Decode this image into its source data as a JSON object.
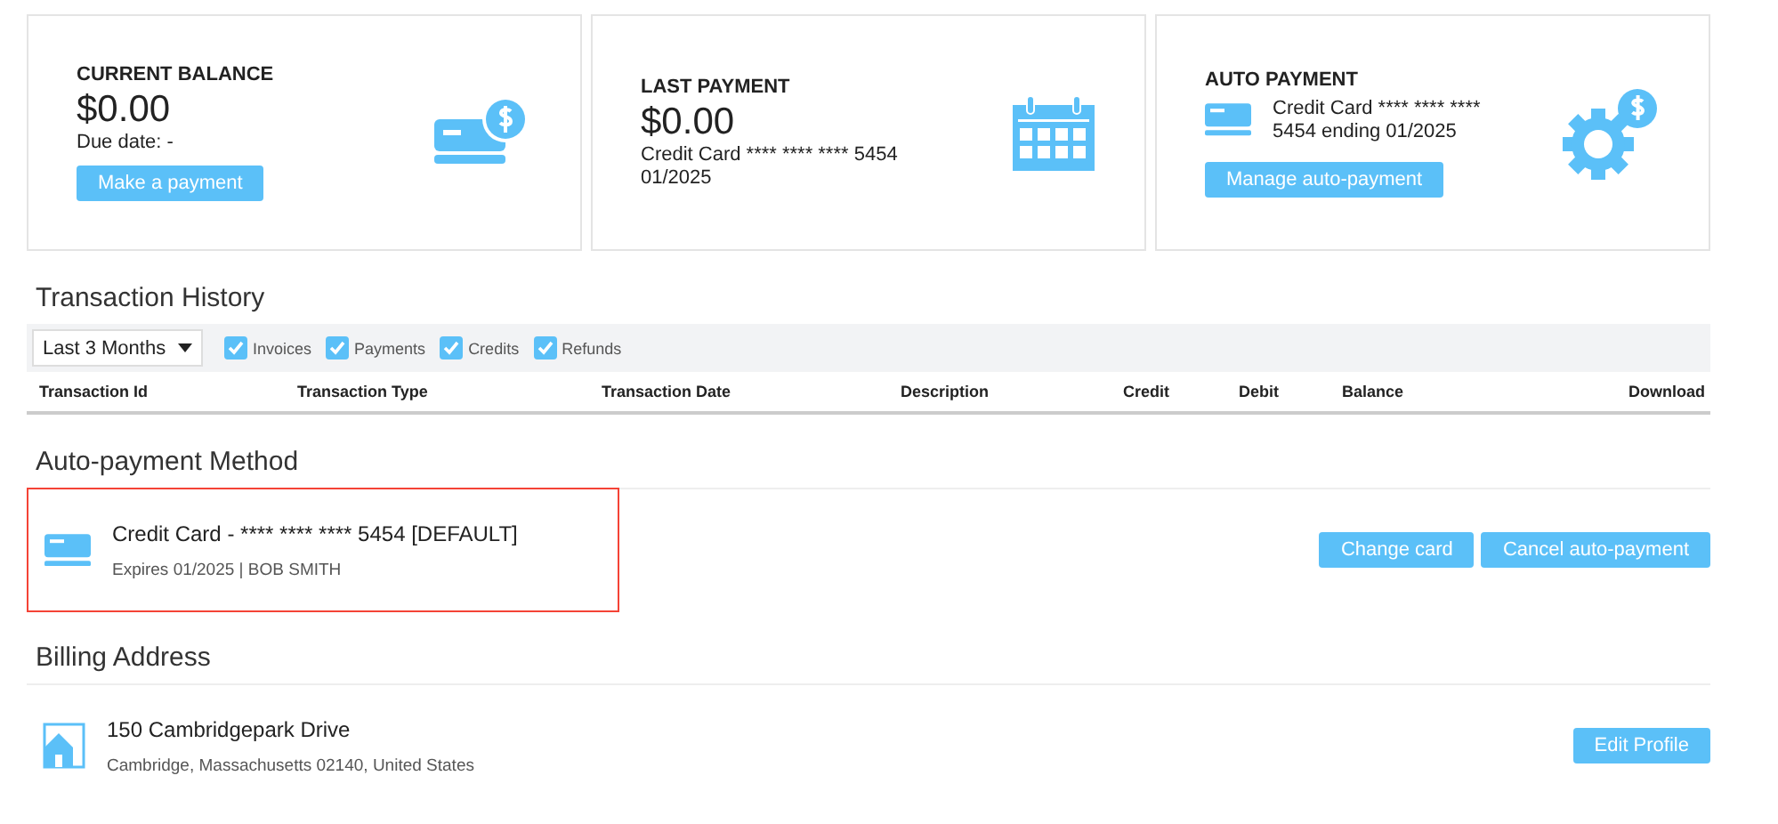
{
  "cards": [
    {
      "kind": "balance",
      "title": "CURRENT BALANCE",
      "amount": "$0.00",
      "lines": [
        "Due date: -"
      ],
      "button": "Make a payment"
    },
    {
      "kind": "last",
      "title": "LAST PAYMENT",
      "amount": "$0.00",
      "lines": [
        "Credit Card **** **** **** 5454",
        "01/2025"
      ]
    },
    {
      "kind": "auto",
      "title": "AUTO PAYMENT",
      "lines": [
        "Credit Card **** **** ****",
        "5454 ending 01/2025"
      ],
      "button": "Manage auto-payment"
    }
  ],
  "transaction_history": {
    "title": "Transaction History",
    "period": "Last 3 Months",
    "filters": [
      {
        "label": "Invoices",
        "checked": true
      },
      {
        "label": "Payments",
        "checked": true
      },
      {
        "label": "Credits",
        "checked": true
      },
      {
        "label": "Refunds",
        "checked": true
      }
    ],
    "columns": [
      "Transaction Id",
      "Transaction Type",
      "Transaction Date",
      "Description",
      "Credit",
      "Debit",
      "Balance",
      "Download"
    ]
  },
  "auto_payment_method": {
    "title": "Auto-payment Method",
    "highlighted": true,
    "name": "Credit Card - **** **** **** 5454 [DEFAULT]",
    "detail": "Expires 01/2025 | BOB SMITH",
    "buttons": [
      "Change card",
      "Cancel auto-payment"
    ]
  },
  "billing_address": {
    "title": "Billing Address",
    "street": "150 Cambridgepark Drive",
    "city": "Cambridge, Massachusetts 02140, United States",
    "button": "Edit Profile"
  }
}
